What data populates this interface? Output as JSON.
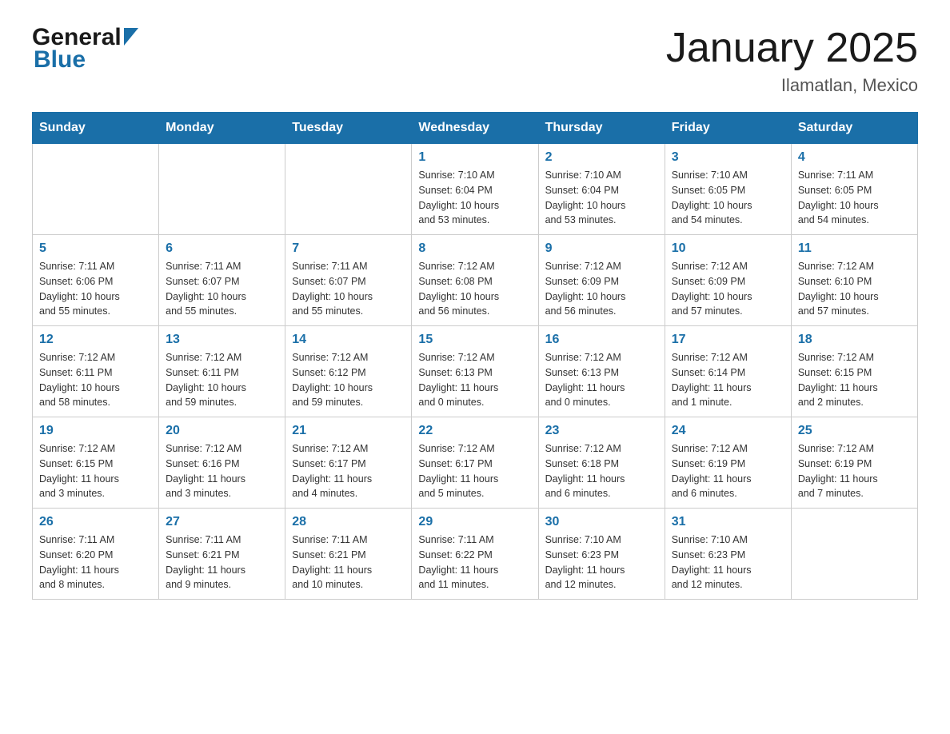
{
  "header": {
    "logo_general": "General",
    "logo_blue": "Blue",
    "title": "January 2025",
    "subtitle": "Ilamatlan, Mexico"
  },
  "weekdays": [
    "Sunday",
    "Monday",
    "Tuesday",
    "Wednesday",
    "Thursday",
    "Friday",
    "Saturday"
  ],
  "weeks": [
    [
      {
        "day": "",
        "info": ""
      },
      {
        "day": "",
        "info": ""
      },
      {
        "day": "",
        "info": ""
      },
      {
        "day": "1",
        "info": "Sunrise: 7:10 AM\nSunset: 6:04 PM\nDaylight: 10 hours\nand 53 minutes."
      },
      {
        "day": "2",
        "info": "Sunrise: 7:10 AM\nSunset: 6:04 PM\nDaylight: 10 hours\nand 53 minutes."
      },
      {
        "day": "3",
        "info": "Sunrise: 7:10 AM\nSunset: 6:05 PM\nDaylight: 10 hours\nand 54 minutes."
      },
      {
        "day": "4",
        "info": "Sunrise: 7:11 AM\nSunset: 6:05 PM\nDaylight: 10 hours\nand 54 minutes."
      }
    ],
    [
      {
        "day": "5",
        "info": "Sunrise: 7:11 AM\nSunset: 6:06 PM\nDaylight: 10 hours\nand 55 minutes."
      },
      {
        "day": "6",
        "info": "Sunrise: 7:11 AM\nSunset: 6:07 PM\nDaylight: 10 hours\nand 55 minutes."
      },
      {
        "day": "7",
        "info": "Sunrise: 7:11 AM\nSunset: 6:07 PM\nDaylight: 10 hours\nand 55 minutes."
      },
      {
        "day": "8",
        "info": "Sunrise: 7:12 AM\nSunset: 6:08 PM\nDaylight: 10 hours\nand 56 minutes."
      },
      {
        "day": "9",
        "info": "Sunrise: 7:12 AM\nSunset: 6:09 PM\nDaylight: 10 hours\nand 56 minutes."
      },
      {
        "day": "10",
        "info": "Sunrise: 7:12 AM\nSunset: 6:09 PM\nDaylight: 10 hours\nand 57 minutes."
      },
      {
        "day": "11",
        "info": "Sunrise: 7:12 AM\nSunset: 6:10 PM\nDaylight: 10 hours\nand 57 minutes."
      }
    ],
    [
      {
        "day": "12",
        "info": "Sunrise: 7:12 AM\nSunset: 6:11 PM\nDaylight: 10 hours\nand 58 minutes."
      },
      {
        "day": "13",
        "info": "Sunrise: 7:12 AM\nSunset: 6:11 PM\nDaylight: 10 hours\nand 59 minutes."
      },
      {
        "day": "14",
        "info": "Sunrise: 7:12 AM\nSunset: 6:12 PM\nDaylight: 10 hours\nand 59 minutes."
      },
      {
        "day": "15",
        "info": "Sunrise: 7:12 AM\nSunset: 6:13 PM\nDaylight: 11 hours\nand 0 minutes."
      },
      {
        "day": "16",
        "info": "Sunrise: 7:12 AM\nSunset: 6:13 PM\nDaylight: 11 hours\nand 0 minutes."
      },
      {
        "day": "17",
        "info": "Sunrise: 7:12 AM\nSunset: 6:14 PM\nDaylight: 11 hours\nand 1 minute."
      },
      {
        "day": "18",
        "info": "Sunrise: 7:12 AM\nSunset: 6:15 PM\nDaylight: 11 hours\nand 2 minutes."
      }
    ],
    [
      {
        "day": "19",
        "info": "Sunrise: 7:12 AM\nSunset: 6:15 PM\nDaylight: 11 hours\nand 3 minutes."
      },
      {
        "day": "20",
        "info": "Sunrise: 7:12 AM\nSunset: 6:16 PM\nDaylight: 11 hours\nand 3 minutes."
      },
      {
        "day": "21",
        "info": "Sunrise: 7:12 AM\nSunset: 6:17 PM\nDaylight: 11 hours\nand 4 minutes."
      },
      {
        "day": "22",
        "info": "Sunrise: 7:12 AM\nSunset: 6:17 PM\nDaylight: 11 hours\nand 5 minutes."
      },
      {
        "day": "23",
        "info": "Sunrise: 7:12 AM\nSunset: 6:18 PM\nDaylight: 11 hours\nand 6 minutes."
      },
      {
        "day": "24",
        "info": "Sunrise: 7:12 AM\nSunset: 6:19 PM\nDaylight: 11 hours\nand 6 minutes."
      },
      {
        "day": "25",
        "info": "Sunrise: 7:12 AM\nSunset: 6:19 PM\nDaylight: 11 hours\nand 7 minutes."
      }
    ],
    [
      {
        "day": "26",
        "info": "Sunrise: 7:11 AM\nSunset: 6:20 PM\nDaylight: 11 hours\nand 8 minutes."
      },
      {
        "day": "27",
        "info": "Sunrise: 7:11 AM\nSunset: 6:21 PM\nDaylight: 11 hours\nand 9 minutes."
      },
      {
        "day": "28",
        "info": "Sunrise: 7:11 AM\nSunset: 6:21 PM\nDaylight: 11 hours\nand 10 minutes."
      },
      {
        "day": "29",
        "info": "Sunrise: 7:11 AM\nSunset: 6:22 PM\nDaylight: 11 hours\nand 11 minutes."
      },
      {
        "day": "30",
        "info": "Sunrise: 7:10 AM\nSunset: 6:23 PM\nDaylight: 11 hours\nand 12 minutes."
      },
      {
        "day": "31",
        "info": "Sunrise: 7:10 AM\nSunset: 6:23 PM\nDaylight: 11 hours\nand 12 minutes."
      },
      {
        "day": "",
        "info": ""
      }
    ]
  ]
}
